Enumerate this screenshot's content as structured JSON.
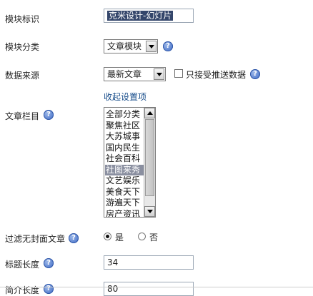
{
  "module_id": {
    "label": "模块标识",
    "value": "克米设计-幻灯片"
  },
  "module_category": {
    "label": "模块分类",
    "selected": "文章模块"
  },
  "data_source": {
    "label": "数据来源",
    "selected": "最新文章",
    "push_only_label": "只接受推送数据",
    "push_only_checked": false
  },
  "collapse_link": "收起设置项",
  "article_column": {
    "label": "文章栏目",
    "items": [
      "全部分类",
      "聚焦社区",
      "大苏城事",
      "国内民生",
      "社会百科",
      "社图来秀",
      "文艺娱乐",
      "美食天下",
      "游遍天下",
      "房产资讯"
    ],
    "selected_index": 5
  },
  "filter_no_cover": {
    "label": "过滤无封面文章",
    "yes": "是",
    "no": "否",
    "selected": "yes"
  },
  "title_length": {
    "label": "标题长度",
    "value": "34"
  },
  "summary_length": {
    "label": "简介长度",
    "value": "80"
  },
  "help_icon_glyph": "?"
}
